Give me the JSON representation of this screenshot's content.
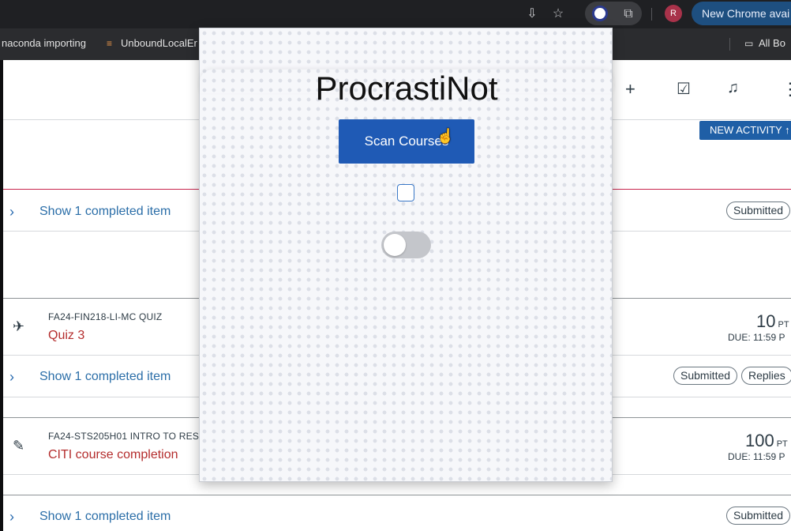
{
  "browser": {
    "update_label": "New Chrome avai",
    "profile_initial": "R",
    "bookmarks": [
      "naconda importing",
      "UnboundLocalEr",
      "All Bo"
    ]
  },
  "page": {
    "new_activity_label": "NEW ACTIVITY",
    "show_completed": "Show 1 completed item",
    "items": [
      {
        "course": "FA24-FIN218-LI-MC QUIZ",
        "title": "Quiz 3",
        "points": "10",
        "points_unit": "PT",
        "due": "DUE: 11:59 P"
      },
      {
        "course": "FA24-STS205H01 INTRO TO RES",
        "title": "CITI course completion",
        "points": "100",
        "points_unit": "PT",
        "due": "DUE: 11:59 P"
      }
    ],
    "pills": {
      "submitted": "Submitted",
      "replies": "Replies"
    }
  },
  "popup": {
    "title": "ProcrastiNot",
    "scan_button": "Scan Courses",
    "checkbox_checked": false,
    "toggle_on": false
  },
  "colors": {
    "accent": "#1f5ab5",
    "link": "#2b6ea8",
    "item_title": "#b42d2d"
  }
}
